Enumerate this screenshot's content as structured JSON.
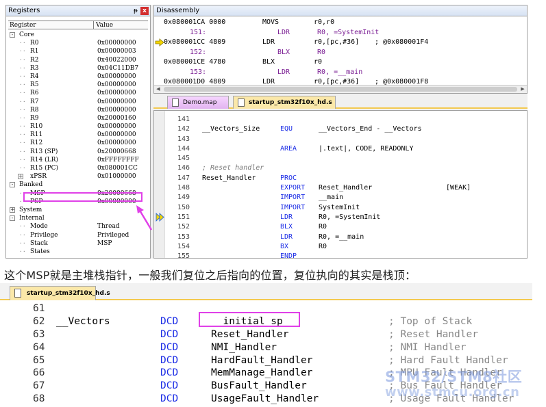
{
  "registers": {
    "title": "Registers",
    "pin_glyph": "ᵽ",
    "close_glyph": "x",
    "col_register": "Register",
    "col_value": "Value",
    "rows": [
      {
        "name": "Core",
        "value": "",
        "type": "group",
        "expander": "-"
      },
      {
        "name": "R0",
        "value": "0x00000000",
        "type": "reg"
      },
      {
        "name": "R1",
        "value": "0x00000003",
        "type": "reg"
      },
      {
        "name": "R2",
        "value": "0x40022000",
        "type": "reg"
      },
      {
        "name": "R3",
        "value": "0x04C11DB7",
        "type": "reg"
      },
      {
        "name": "R4",
        "value": "0x00000000",
        "type": "reg"
      },
      {
        "name": "R5",
        "value": "0x00000000",
        "type": "reg"
      },
      {
        "name": "R6",
        "value": "0x00000000",
        "type": "reg"
      },
      {
        "name": "R7",
        "value": "0x00000000",
        "type": "reg"
      },
      {
        "name": "R8",
        "value": "0x00000000",
        "type": "reg"
      },
      {
        "name": "R9",
        "value": "0x20000160",
        "type": "reg"
      },
      {
        "name": "R10",
        "value": "0x00000000",
        "type": "reg"
      },
      {
        "name": "R11",
        "value": "0x00000000",
        "type": "reg"
      },
      {
        "name": "R12",
        "value": "0x00000000",
        "type": "reg"
      },
      {
        "name": "R13 (SP)",
        "value": "0x20000668",
        "type": "reg"
      },
      {
        "name": "R14 (LR)",
        "value": "0xFFFFFFFF",
        "type": "reg"
      },
      {
        "name": "R15 (PC)",
        "value": "0x080001CC",
        "type": "reg"
      },
      {
        "name": "xPSR",
        "value": "0x01000000",
        "type": "reg",
        "expander": "+"
      },
      {
        "name": "Banked",
        "value": "",
        "type": "group",
        "expander": "-"
      },
      {
        "name": "MSP",
        "value": "0x20000668",
        "type": "reg"
      },
      {
        "name": "PSP",
        "value": "0x00000000",
        "type": "reg"
      },
      {
        "name": "System",
        "value": "",
        "type": "group",
        "expander": "+"
      },
      {
        "name": "Internal",
        "value": "",
        "type": "group",
        "expander": "-"
      },
      {
        "name": "Mode",
        "value": "Thread",
        "type": "reg"
      },
      {
        "name": "Privilege",
        "value": "Privileged",
        "type": "reg"
      },
      {
        "name": "Stack",
        "value": "MSP",
        "type": "reg"
      },
      {
        "name": "States",
        "value": "",
        "type": "reg"
      }
    ]
  },
  "disassembly": {
    "title": "Disassembly",
    "lines": [
      {
        "kind": "asm",
        "addr": "0x080001CA 0000",
        "op": "MOVS",
        "args": "r0,r0",
        "comment": "",
        "current": false
      },
      {
        "kind": "src",
        "num": "151:",
        "op": "LDR",
        "args": "R0, =SystemInit",
        "current": false
      },
      {
        "kind": "asm",
        "addr": "0x080001CC 4809",
        "op": "LDR",
        "args": "r0,[pc,#36]",
        "comment": "; @0x080001F4",
        "current": true
      },
      {
        "kind": "src",
        "num": "152:",
        "op": "BLX",
        "args": "R0",
        "current": false
      },
      {
        "kind": "asm",
        "addr": "0x080001CE 4780",
        "op": "BLX",
        "args": "r0",
        "comment": "",
        "current": false
      },
      {
        "kind": "src",
        "num": "153:",
        "op": "LDR",
        "args": "R0, =__main",
        "current": false
      },
      {
        "kind": "asm",
        "addr": "0x080001D0 4809",
        "op": "LDR",
        "args": "r0,[pc,#36]",
        "comment": "; @0x080001F8",
        "current": false
      }
    ]
  },
  "editor_tabs": [
    {
      "label": "Demo.map",
      "active": false
    },
    {
      "label": "startup_stm32f10x_hd.s",
      "active": true
    }
  ],
  "editor": {
    "lines": [
      {
        "num": "141",
        "label": "",
        "op": "",
        "args": "",
        "extra": "",
        "comment": ""
      },
      {
        "num": "142",
        "label": "__Vectors_Size",
        "op": "EQU",
        "args": "__Vectors_End - __Vectors",
        "extra": "",
        "comment": ""
      },
      {
        "num": "143",
        "label": "",
        "op": "",
        "args": "",
        "extra": "",
        "comment": ""
      },
      {
        "num": "144",
        "label": "",
        "op": "AREA",
        "args": "|.text|, CODE, READONLY",
        "extra": "",
        "comment": ""
      },
      {
        "num": "145",
        "label": "",
        "op": "",
        "args": "",
        "extra": "",
        "comment": ""
      },
      {
        "num": "146",
        "label": "",
        "op": "",
        "args": "",
        "extra": "",
        "comment": "; Reset handler"
      },
      {
        "num": "147",
        "label": "Reset_Handler",
        "op": "PROC",
        "args": "",
        "extra": "",
        "comment": ""
      },
      {
        "num": "148",
        "label": "",
        "op": "EXPORT",
        "args": "Reset_Handler",
        "extra": "[WEAK]",
        "comment": ""
      },
      {
        "num": "149",
        "label": "",
        "op": "IMPORT",
        "args": "__main",
        "extra": "",
        "comment": ""
      },
      {
        "num": "150",
        "label": "",
        "op": "IMPORT",
        "args": "SystemInit",
        "extra": "",
        "comment": ""
      },
      {
        "num": "151",
        "label": "",
        "op": "LDR",
        "args": "R0, =SystemInit",
        "extra": "",
        "comment": "",
        "current": true
      },
      {
        "num": "152",
        "label": "",
        "op": "BLX",
        "args": "R0",
        "extra": "",
        "comment": ""
      },
      {
        "num": "153",
        "label": "",
        "op": "LDR",
        "args": "R0, =__main",
        "extra": "",
        "comment": ""
      },
      {
        "num": "154",
        "label": "",
        "op": "BX",
        "args": "R0",
        "extra": "",
        "comment": ""
      },
      {
        "num": "155",
        "label": "",
        "op": "ENDP",
        "args": "",
        "extra": "",
        "comment": ""
      }
    ]
  },
  "caption": "这个MSP就是主堆栈指针，一般我们复位之后指向的位置，复位执向的其实是栈顶：",
  "bottom": {
    "tab_label": "startup_stm32f10x_hd.s",
    "lines": [
      {
        "num": "61",
        "label": "",
        "op": "",
        "args": "",
        "comment": ""
      },
      {
        "num": "62",
        "label": "__Vectors",
        "op": "DCD",
        "args": "__initial_sp",
        "comment": "; Top of Stack"
      },
      {
        "num": "63",
        "label": "",
        "op": "DCD",
        "args": "Reset_Handler",
        "comment": "; Reset Handler"
      },
      {
        "num": "64",
        "label": "",
        "op": "DCD",
        "args": "NMI_Handler",
        "comment": "; NMI Handler"
      },
      {
        "num": "65",
        "label": "",
        "op": "DCD",
        "args": "HardFault_Handler",
        "comment": "; Hard Fault Handler"
      },
      {
        "num": "66",
        "label": "",
        "op": "DCD",
        "args": "MemManage_Handler",
        "comment": "; MPU Fault Handler"
      },
      {
        "num": "67",
        "label": "",
        "op": "DCD",
        "args": "BusFault_Handler",
        "comment": "; Bus Fault Handler"
      },
      {
        "num": "68",
        "label": "",
        "op": "DCD",
        "args": "UsageFault_Handler",
        "comment": "; Usage Fault Handler"
      }
    ]
  },
  "watermark": {
    "line1": "STM32/STM8社区",
    "line2": "www.stmcu.org.cn"
  },
  "colors": {
    "highlight_box": "#e040e8",
    "keyword": "#1d2ee6",
    "source_line": "#7a1d93",
    "tab_active": "#fbe8a9",
    "tab_underline": "#f3c94f",
    "current_line_arrow": "#f3d400"
  }
}
